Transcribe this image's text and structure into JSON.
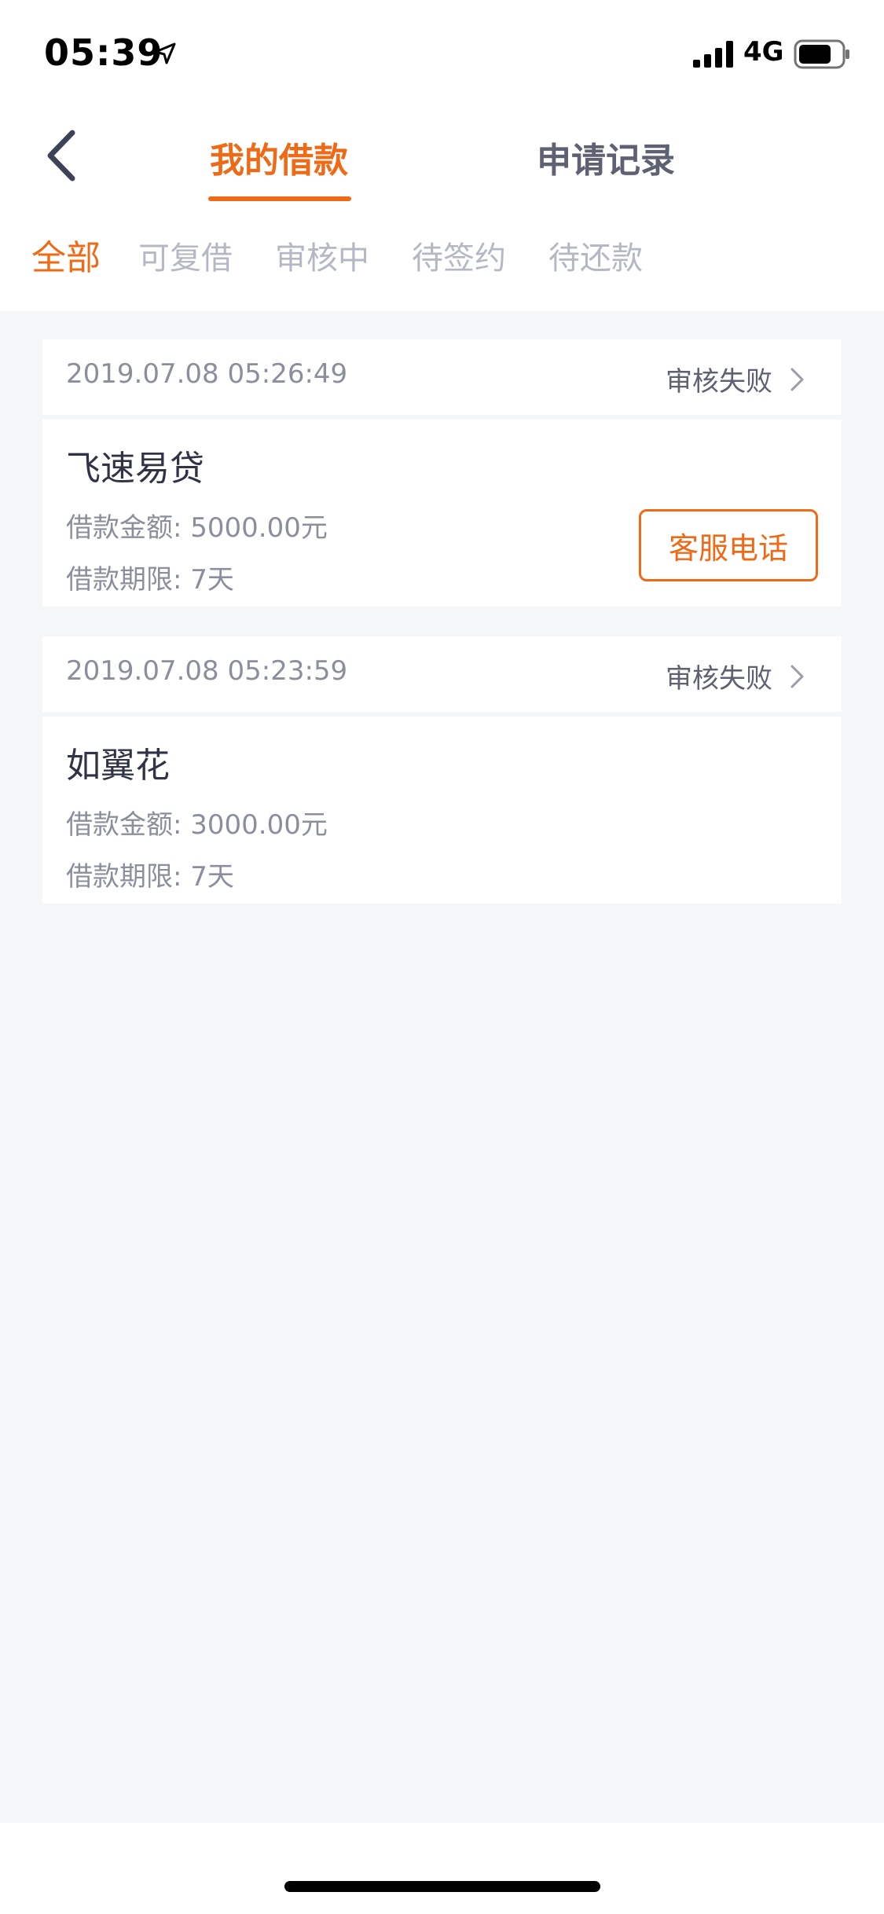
{
  "status_bar": {
    "time": "05:39",
    "network": "4G",
    "icons": [
      "location-arrow-icon",
      "signal-icon",
      "battery-icon"
    ]
  },
  "header": {
    "back_icon": "chevron-left-icon",
    "tabs": [
      {
        "label": "我的借款",
        "active": true
      },
      {
        "label": "申请记录",
        "active": false
      }
    ]
  },
  "filters": [
    {
      "label": "全部",
      "active": true
    },
    {
      "label": "可复借",
      "active": false
    },
    {
      "label": "审核中",
      "active": false
    },
    {
      "label": "待签约",
      "active": false
    },
    {
      "label": "待还款",
      "active": false
    }
  ],
  "loans": [
    {
      "datetime": "2019.07.08 05:26:49",
      "status": "审核失败",
      "name": "飞速易贷",
      "amount_label": "借款金额: ",
      "amount": "5000.00元",
      "term_label": "借款期限: ",
      "term": "7天",
      "action_label": "客服电话"
    },
    {
      "datetime": "2019.07.08 05:23:59",
      "status": "审核失败",
      "name": "如翼花",
      "amount_label": "借款金额: ",
      "amount": "3000.00元",
      "term_label": "借款期限: ",
      "term": "7天"
    }
  ],
  "colors": {
    "accent": "#ee6a16",
    "background": "#f5f6f8",
    "text_primary": "#2f3345",
    "text_secondary": "#8b8f9c",
    "text_disabled": "#b4b8c3"
  }
}
